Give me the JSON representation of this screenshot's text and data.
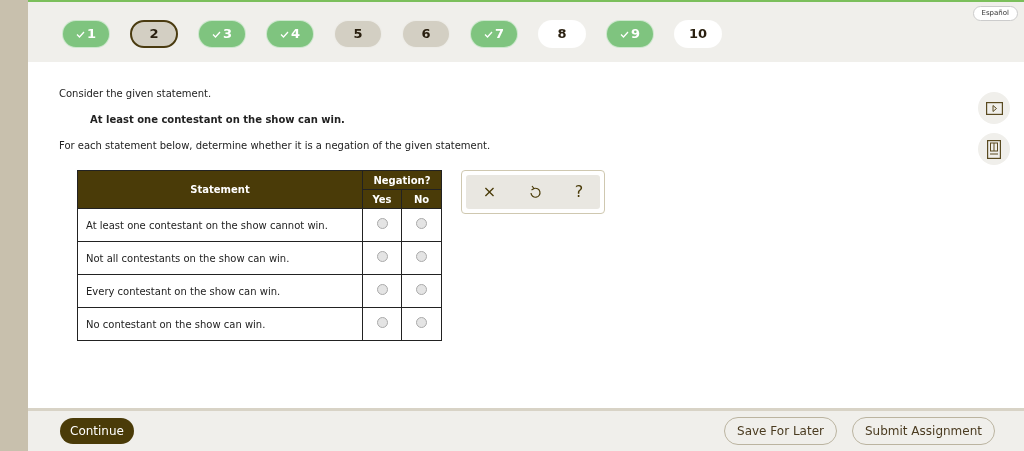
{
  "questions": [
    {
      "label": "1",
      "kind": "done",
      "selected": false
    },
    {
      "label": "2",
      "kind": "visited",
      "selected": true
    },
    {
      "label": "3",
      "kind": "done",
      "selected": false
    },
    {
      "label": "4",
      "kind": "done",
      "selected": false
    },
    {
      "label": "5",
      "kind": "visited",
      "selected": false
    },
    {
      "label": "6",
      "kind": "visited",
      "selected": false
    },
    {
      "label": "7",
      "kind": "done",
      "selected": false
    },
    {
      "label": "8",
      "kind": "unvisited",
      "selected": false
    },
    {
      "label": "9",
      "kind": "done",
      "selected": false
    },
    {
      "label": "10",
      "kind": "unvisited",
      "selected": false
    }
  ],
  "language_button": "Español",
  "intro": "Consider the given statement.",
  "statement": "At least one contestant on the show can win.",
  "instruction": "For each statement below, determine whether it is a negation of the given statement.",
  "table": {
    "statement_header": "Statement",
    "group_header": "Negation?",
    "yes_header": "Yes",
    "no_header": "No",
    "rows": [
      {
        "text": "At least one contestant on the show cannot win.",
        "yes": false,
        "no": false
      },
      {
        "text": "Not all contestants on the show can win.",
        "yes": false,
        "no": false
      },
      {
        "text": "Every contestant on the show can win.",
        "yes": false,
        "no": false
      },
      {
        "text": "No contestant on the show can win.",
        "yes": false,
        "no": false
      }
    ]
  },
  "tools": [
    "×",
    "?"
  ],
  "footer": {
    "continue": "Continue",
    "save": "Save For Later",
    "submit": "Submit Assignment"
  }
}
